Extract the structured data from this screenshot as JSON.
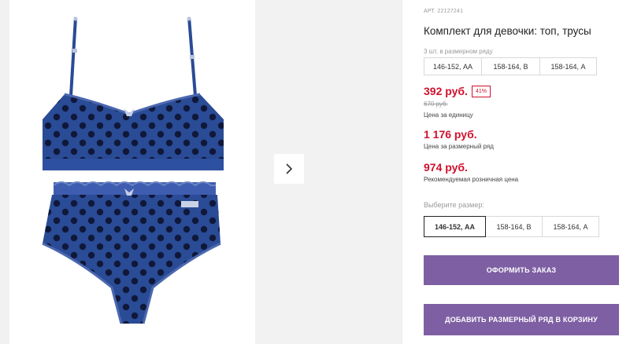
{
  "product": {
    "article": "АРТ. 22127241",
    "title": "Комплект для девочки: топ, трусы",
    "pack_note": "3 шт. в размерном ряду",
    "pack_sizes": [
      "146-152, АА",
      "158-164, В",
      "158-164, А"
    ]
  },
  "pricing": {
    "unit_price": "392 руб.",
    "discount": "41%",
    "old_price": "670 руб.",
    "unit_label": "Цена за единицу",
    "series_price": "1 176 руб.",
    "series_label": "Цена за размерный ряд",
    "retail_price": "974 руб.",
    "retail_label": "Рекомендуемая розничная цена"
  },
  "size_selector": {
    "label": "Выберите размер:",
    "options": [
      "146-152, АА",
      "158-164, В",
      "158-164, А"
    ],
    "selected_index": 0
  },
  "actions": {
    "order": "ОФОРМИТЬ ЗАКАЗ",
    "add_series": "ДОБАВИТЬ РАЗМЕРНЫЙ РЯД В КОРЗИНУ"
  },
  "gallery": {
    "next_icon": "chevron-right-icon",
    "garment_color": "#2a4b95",
    "dot_color": "#10183a",
    "accent": "#7e5fa3",
    "price_color": "#d0102c"
  }
}
